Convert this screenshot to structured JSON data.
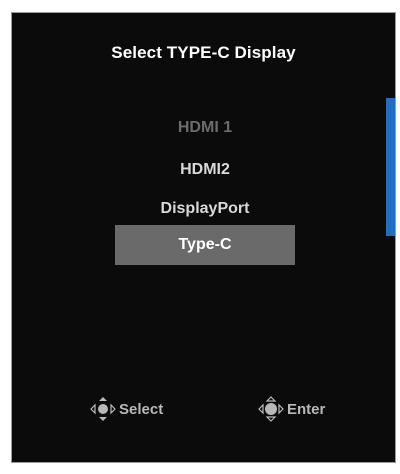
{
  "osd": {
    "title": "Select TYPE-C Display",
    "options": [
      {
        "label": "HDMI 1",
        "state": "disabled"
      },
      {
        "label": "HDMI2",
        "state": "normal"
      },
      {
        "label": "DisplayPort",
        "state": "normal"
      },
      {
        "label": "Type-C",
        "state": "selected"
      }
    ],
    "hints": {
      "select_label": "Select",
      "select_icon": "joystick-updown-icon",
      "enter_label": "Enter",
      "enter_icon": "joystick-press-icon"
    },
    "colors": {
      "background": "#0b0b0b",
      "selected_bg": "#6a6a6a",
      "scrollbar": "#1f6ec4",
      "disabled_text": "#6c6c6c"
    }
  }
}
